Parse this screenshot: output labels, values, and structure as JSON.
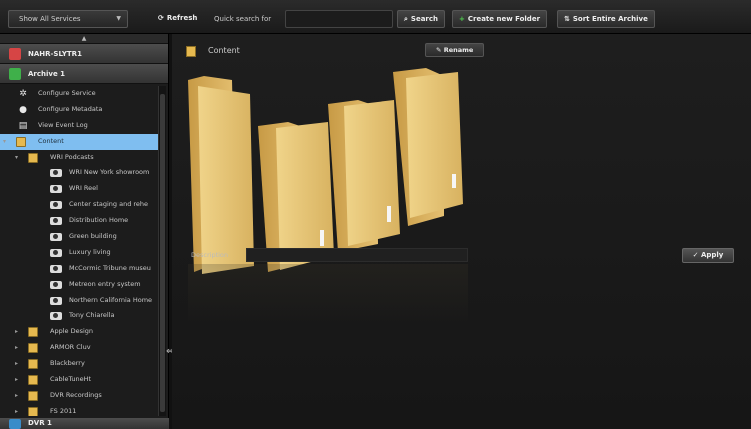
{
  "toolbar": {
    "service_filter": "Show All Services",
    "refresh_label": "Refresh",
    "quick_search_label": "Quick search for",
    "quick_search_value": "",
    "search_label": "Search",
    "create_folder_label": "Create new Folder",
    "sort_label": "Sort Entire Archive"
  },
  "left_panel": {
    "collapse_glyph": "▲",
    "server_name": "NAHR-SLYTR1",
    "archive_name": "Archive 1",
    "tree": [
      {
        "label": "Configure Service",
        "icon": "gear-icon",
        "indent": 0
      },
      {
        "label": "Configure Metadata",
        "icon": "pin-icon",
        "indent": 0
      },
      {
        "label": "View Event Log",
        "icon": "document-icon",
        "indent": 0
      },
      {
        "label": "Content",
        "icon": "folder-icon",
        "indent": 0,
        "selected": true,
        "expanded": true
      },
      {
        "label": "WRI Podcasts",
        "icon": "folder-icon",
        "indent": 1,
        "expanded": true
      },
      {
        "label": "WRI New York showroom",
        "icon": "video-icon",
        "indent": 2
      },
      {
        "label": "WRI Reel",
        "icon": "video-icon",
        "indent": 2
      },
      {
        "label": "Center staging and rehe",
        "icon": "video-icon",
        "indent": 2
      },
      {
        "label": "Distribution Home",
        "icon": "video-icon",
        "indent": 2
      },
      {
        "label": "Green building",
        "icon": "video-icon",
        "indent": 2
      },
      {
        "label": "Luxury living",
        "icon": "video-icon",
        "indent": 2
      },
      {
        "label": "McCormic Tribune museu",
        "icon": "video-icon",
        "indent": 2
      },
      {
        "label": "Metreon entry system",
        "icon": "video-icon",
        "indent": 2
      },
      {
        "label": "Northern California Home",
        "icon": "video-icon",
        "indent": 2
      },
      {
        "label": "Tony Chiarella",
        "icon": "video-icon",
        "indent": 2
      },
      {
        "label": "Apple Design",
        "icon": "folder-icon",
        "indent": 1
      },
      {
        "label": "ARMOR Cluv",
        "icon": "folder-icon",
        "indent": 1
      },
      {
        "label": "Blackberry",
        "icon": "folder-icon",
        "indent": 1
      },
      {
        "label": "CableTuneHt",
        "icon": "folder-icon",
        "indent": 1
      },
      {
        "label": "DVR Recordings",
        "icon": "folder-icon",
        "indent": 1
      },
      {
        "label": "FS 2011",
        "icon": "folder-icon",
        "indent": 1
      }
    ],
    "bottom_server": "DVR 1"
  },
  "main": {
    "title": "Content",
    "rename_label": "Rename",
    "description_label": "Description",
    "description_value": "",
    "apply_label": "Apply"
  },
  "colors": {
    "server_status": "#d64545",
    "archive_status": "#3fb04a",
    "selection": "#7fbef0",
    "folder": "#e6b94f"
  }
}
